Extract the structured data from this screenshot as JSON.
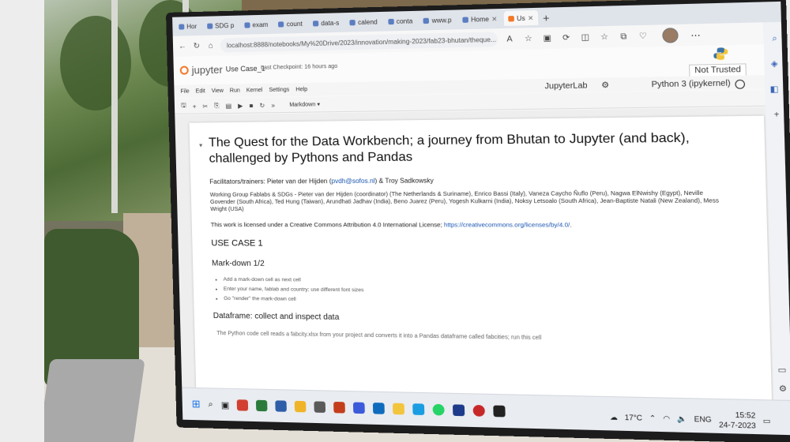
{
  "browser": {
    "tabs": [
      {
        "label": "Hor"
      },
      {
        "label": "SDG p"
      },
      {
        "label": "exam"
      },
      {
        "label": "count"
      },
      {
        "label": "data-s"
      },
      {
        "label": "calend"
      },
      {
        "label": "conta"
      },
      {
        "label": "www.p"
      },
      {
        "label": "Home"
      },
      {
        "label": "Us"
      }
    ],
    "new_tab_label": "+",
    "url": "localhost:8888/notebooks/My%20Drive/2023/innovation/making-2023/fab23-bhutan/theque..."
  },
  "jupyter": {
    "logo_text": "jupyter",
    "notebook_name": "Use Case_1",
    "checkpoint": "Last Checkpoint: 16 hours ago",
    "trust_status": "Not Trusted",
    "menu": [
      "File",
      "Edit",
      "View",
      "Run",
      "Kernel",
      "Settings",
      "Help"
    ],
    "lab_link": "JupyterLab",
    "kernel_name": "Python 3 (ipykernel)",
    "cell_type": "Markdown"
  },
  "notebook": {
    "title": "The Quest for the Data Workbench; a journey from Bhutan to Jupyter (and back), challenged by Pythons and Pandas",
    "facilitators_prefix": "Facilitators/trainers: Pieter van der Hijden (",
    "facilitators_email": "pvdh@sofos.nl",
    "facilitators_suffix": ") & Troy Sadkowsky",
    "working_group": "Working Group Fablabs & SDGs - Pieter van der Hijden (coordinator) (The Netherlands & Suriname), Enrico Bassi (Italy), Vaneza Caycho Ñuflo (Peru), Nagwa ElNwishy (Egypt), Neville Govender (South Africa), Ted Hung (Taiwan), Arundhati Jadhav (India), Beno Juarez (Peru), Yogesh Kulkarni (India), Noksy Letsoalo (South Africa), Jean-Baptiste Natali (New Zealand), Mess Wright (USA)",
    "license_text": "This work is licensed under a Creative Commons Attribution 4.0 International License; ",
    "license_link": "https://creativecommons.org/licenses/by/4.0/",
    "use_case": "USE CASE 1",
    "markdown_heading": "Mark-down 1/2",
    "bullets": [
      "Add a mark-down cell as next cell",
      "Enter your name, fablab and country; use different font sizes",
      "Go \"render\" the mark-down cell"
    ],
    "dataframe_heading": "Dataframe: collect and inspect data",
    "dataframe_line": "The Python code cell reads a fabcity.xlsx from your project and converts it into a Pandas dataframe called fabcities; run this cell"
  },
  "taskbar": {
    "weather": "17°C",
    "language": "ENG",
    "time": "15:52",
    "date": "24-7-2023"
  },
  "colors": {
    "jupyter_orange": "#f37726",
    "link_blue": "#1a56b0",
    "windows_blue": "#1a73e8"
  }
}
